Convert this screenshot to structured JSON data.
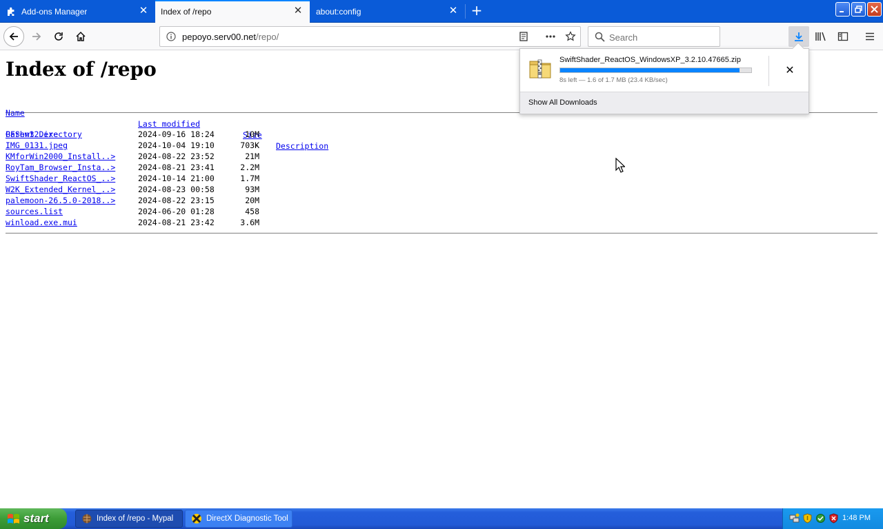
{
  "browser": {
    "tabs": [
      {
        "label": "Add-ons Manager",
        "icon": "puzzle-icon",
        "active": false
      },
      {
        "label": "Index of /repo",
        "icon": "",
        "active": true
      },
      {
        "label": "about:config",
        "icon": "",
        "active": false
      }
    ],
    "new_tab_glyph": "+",
    "close_glyph": "✕",
    "url": {
      "host": "pepoyo.serv00.net",
      "path": "/repo/"
    },
    "search_placeholder": "Search"
  },
  "page": {
    "title": "Index of /repo",
    "headers": {
      "name": "Name",
      "modified": "Last modified",
      "size": "Size",
      "description": "Description"
    },
    "parent": {
      "name": "Parent Directory",
      "size": "-"
    },
    "files": [
      {
        "name": "GFShw32.exe",
        "modified": "2024-09-16 18:24",
        "size": "10M"
      },
      {
        "name": "IMG_0131.jpeg",
        "modified": "2024-10-04 19:10",
        "size": "703K"
      },
      {
        "name": "KMforWin2000_Install..>",
        "modified": "2024-08-22 23:52",
        "size": "21M"
      },
      {
        "name": "RoyTam_Browser_Insta..>",
        "modified": "2024-08-21 23:41",
        "size": "2.2M"
      },
      {
        "name": "SwiftShader_ReactOS_..>",
        "modified": "2024-10-14 21:00",
        "size": "1.7M"
      },
      {
        "name": "W2K_Extended_Kernel_..>",
        "modified": "2024-08-23 00:58",
        "size": "93M"
      },
      {
        "name": "palemoon-26.5.0-2018..>",
        "modified": "2024-08-22 23:15",
        "size": "20M"
      },
      {
        "name": "sources.list",
        "modified": "2024-06-20 01:28",
        "size": "458"
      },
      {
        "name": "winload.exe.mui",
        "modified": "2024-08-21 23:42",
        "size": "3.6M"
      }
    ]
  },
  "downloads": {
    "filename": "SwiftShader_ReactOS_WindowsXP_3.2.10.47665.zip",
    "progress": 0.94,
    "status": "8s left — 1.6 of 1.7 MB (23.4 KB/sec)",
    "cancel_glyph": "✕",
    "show_all": "Show All Downloads"
  },
  "taskbar": {
    "start": "start",
    "tasks": [
      {
        "label": "Index of /repo - Mypal",
        "icon": "mypal-icon",
        "active": true
      },
      {
        "label": "DirectX Diagnostic Tool",
        "icon": "directx-icon",
        "active": false
      }
    ],
    "clock": "1:48 PM"
  },
  "colors": {
    "tabstrip": "#0a5bd8",
    "accent": "#0a84ff",
    "link": "#0000ee",
    "taskbar": "#245edb",
    "start": "#3c9c37",
    "tray": "#128ae0"
  }
}
